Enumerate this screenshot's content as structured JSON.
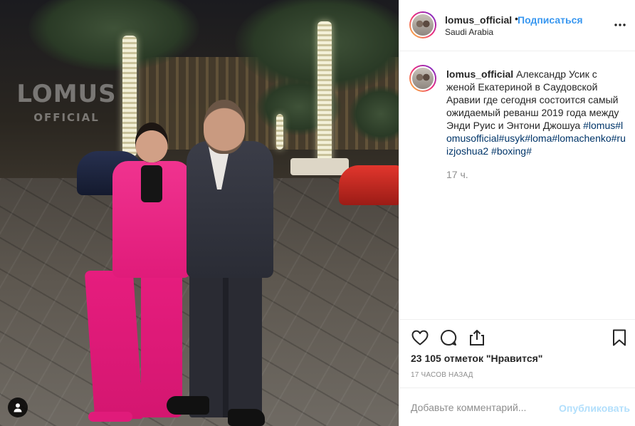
{
  "photo": {
    "watermark_line1": "LOMUS",
    "watermark_line2": "OFFICIAL",
    "tag_icon": "user-tag-icon"
  },
  "header": {
    "username": "lomus_official",
    "separator": "•",
    "follow_label": "Подписаться",
    "location": "Saudi Arabia",
    "more_icon": "more-options-icon"
  },
  "post": {
    "caption_user": "lomus_official",
    "caption_text": "Александр Усик с женой Екатериной в Саудовской Аравии где сегодня состоится самый ожидаемый реванш 2019 года между Энди Руис и Энтони Джошуа",
    "hashtags": "#lomus#lomusofficial#usyk#loma#lomachenko#ruizjoshua2 #boxing#",
    "time_ago": "17 ч."
  },
  "actions": {
    "icons": [
      "heart-icon",
      "comment-icon",
      "share-icon",
      "bookmark-icon"
    ],
    "likes_count": "23 105",
    "likes_label": "отметок \"Нравится\"",
    "posted_ago": "17 ЧАСОВ НАЗАД"
  },
  "comment_box": {
    "placeholder": "Добавьте комментарий...",
    "publish_label": "Опубликовать"
  },
  "colors": {
    "link": "#3897f0",
    "hashtag": "#003569",
    "muted": "#8e8e8e",
    "publish_disabled": "#b2dffc"
  }
}
